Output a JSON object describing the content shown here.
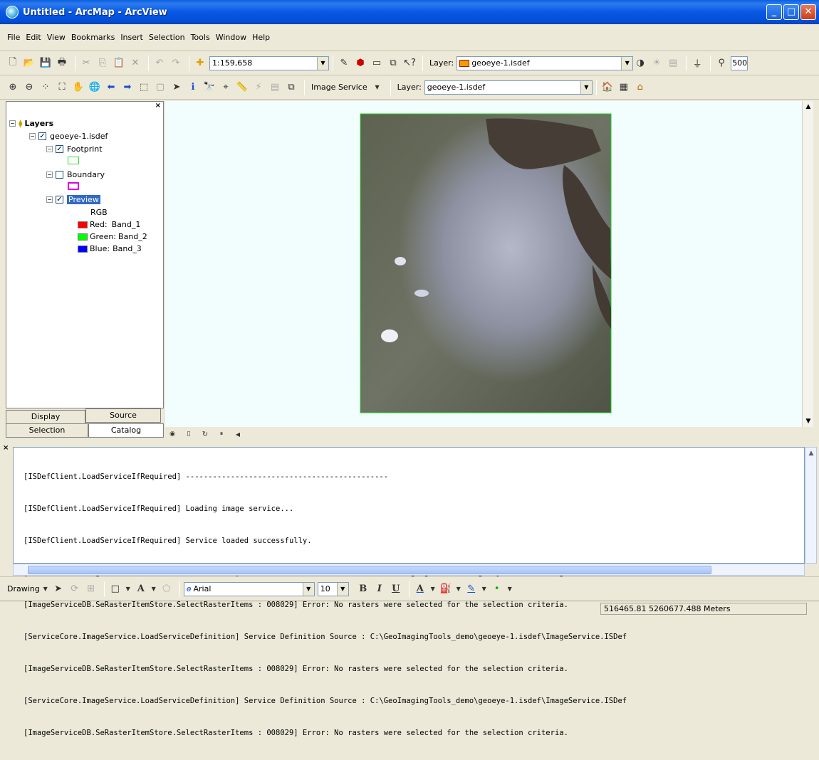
{
  "window": {
    "title": "Untitled - ArcMap - ArcView"
  },
  "menu": [
    "File",
    "Edit",
    "View",
    "Bookmarks",
    "Insert",
    "Selection",
    "Tools",
    "Window",
    "Help"
  ],
  "toolbar1": {
    "scale": "1:159,658",
    "layer_label": "Layer:",
    "layer_value": "geoeye-1.isdef",
    "value_500": "500"
  },
  "toolbar2": {
    "image_service_label": "Image Service",
    "layer_label": "Layer:",
    "layer_value": "geoeye-1.isdef"
  },
  "toc": {
    "root": "Layers",
    "layer": "geoeye-1.isdef",
    "footprint": "Footprint",
    "boundary": "Boundary",
    "preview": "Preview",
    "rgb": "RGB",
    "bands": [
      {
        "label": "Red:",
        "band": "Band_1",
        "color": "#ff0000"
      },
      {
        "label": "Green:",
        "band": "Band_2",
        "color": "#00ff00"
      },
      {
        "label": "Blue:",
        "band": "Band_3",
        "color": "#0000ff"
      }
    ]
  },
  "tabs": {
    "display": "Display",
    "source": "Source",
    "selection": "Selection",
    "catalog": "Catalog"
  },
  "log": [
    "[ISDefClient.LoadServiceIfRequired] ---------------------------------------------",
    "[ISDefClient.LoadServiceIfRequired] Loading image service...",
    "[ISDefClient.LoadServiceIfRequired] Service loaded successfully.",
    "[ServiceCore.ImageService.LoadServiceDefinition] Service Definition Source : C:\\GeoImagingTools_demo\\geoeye-1.isdef\\ImageService.ISDef",
    "[ImageServiceDB.SeRasterItemStore.SelectRasterItems : 008029] Error: No rasters were selected for the selection criteria.",
    "[ServiceCore.ImageService.LoadServiceDefinition] Service Definition Source : C:\\GeoImagingTools_demo\\geoeye-1.isdef\\ImageService.ISDef",
    "[ImageServiceDB.SeRasterItemStore.SelectRasterItems : 008029] Error: No rasters were selected for the selection criteria.",
    "[ServiceCore.ImageService.LoadServiceDefinition] Service Definition Source : C:\\GeoImagingTools_demo\\geoeye-1.isdef\\ImageService.ISDef",
    "[ImageServiceDB.SeRasterItemStore.SelectRasterItems : 008029] Error: No rasters were selected for the selection criteria."
  ],
  "drawing": {
    "label": "Drawing",
    "font": "Arial",
    "size": "10",
    "bold": "B",
    "italic": "I",
    "underline": "U",
    "text_a": "A"
  },
  "status": {
    "coords": "516465.81  5260677.488 Meters"
  }
}
